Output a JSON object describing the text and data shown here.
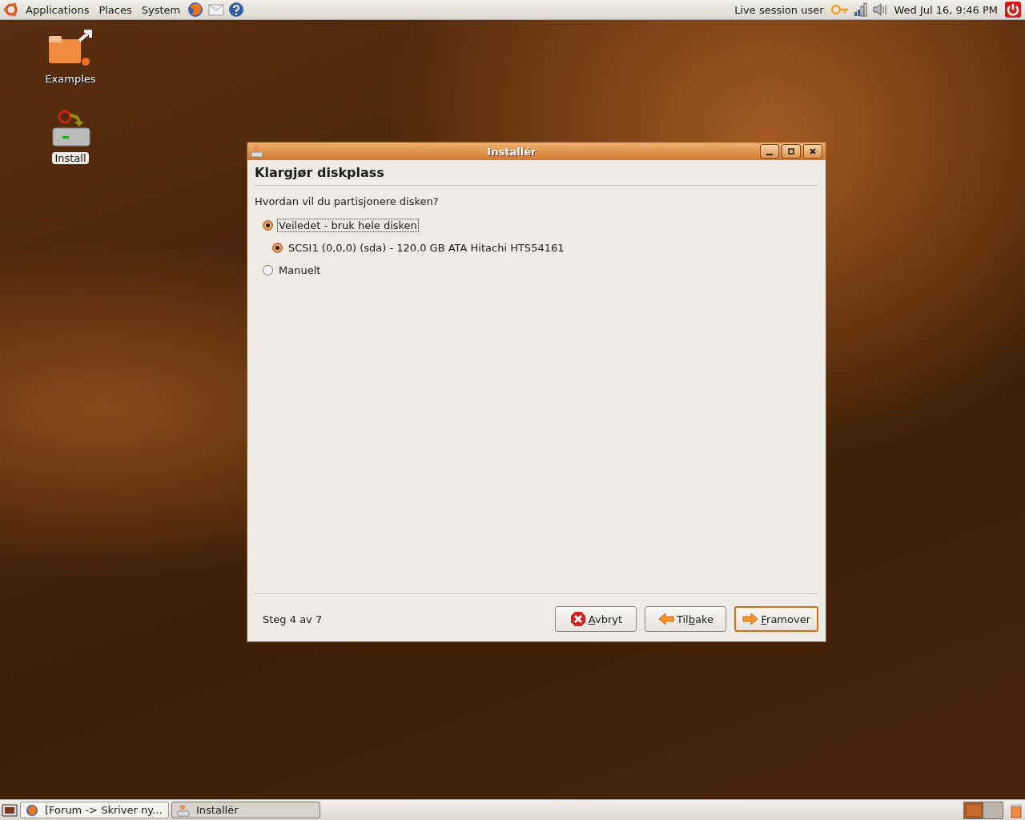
{
  "top_panel": {
    "menus": [
      "Applications",
      "Places",
      "System"
    ],
    "user": "Live session user",
    "clock": "Wed Jul 16,  9:46 PM"
  },
  "desktop_icons": [
    {
      "kind": "folder",
      "label": "Examples",
      "selected": false
    },
    {
      "kind": "installer",
      "label": "Install",
      "selected": true
    }
  ],
  "window": {
    "title": "Installér",
    "heading": "Klargjør diskplass",
    "question": "Hvordan vil du partisjonere disken?",
    "options": [
      {
        "label": "Veiledet - bruk hele disken",
        "selected": true,
        "focused": true,
        "children": [
          {
            "label": "SCSI1 (0,0,0) (sda) - 120.0 GB ATA Hitachi HTS54161",
            "selected": true,
            "focused": false
          }
        ]
      },
      {
        "label": "Manuelt",
        "selected": false,
        "focused": false
      }
    ],
    "step": "Steg 4 av 7",
    "buttons": [
      {
        "kind": "cancel",
        "label": {
          "mnemonic": "A",
          "after": "vbryt"
        },
        "default": false
      },
      {
        "kind": "back",
        "label": {
          "before": "Til",
          "mnemonic": "b",
          "after": "ake"
        },
        "default": false
      },
      {
        "kind": "forward",
        "label": {
          "mnemonic": "F",
          "after": "ramover"
        },
        "default": true
      }
    ]
  },
  "taskbar": {
    "tasks": [
      {
        "kind": "browser",
        "label": "[Forum -> Skriver ny...",
        "selected": false
      },
      {
        "kind": "installer",
        "label": "Installér",
        "selected": true
      }
    ],
    "workspaces": [
      {
        "selected": true
      },
      {
        "selected": false
      }
    ]
  }
}
